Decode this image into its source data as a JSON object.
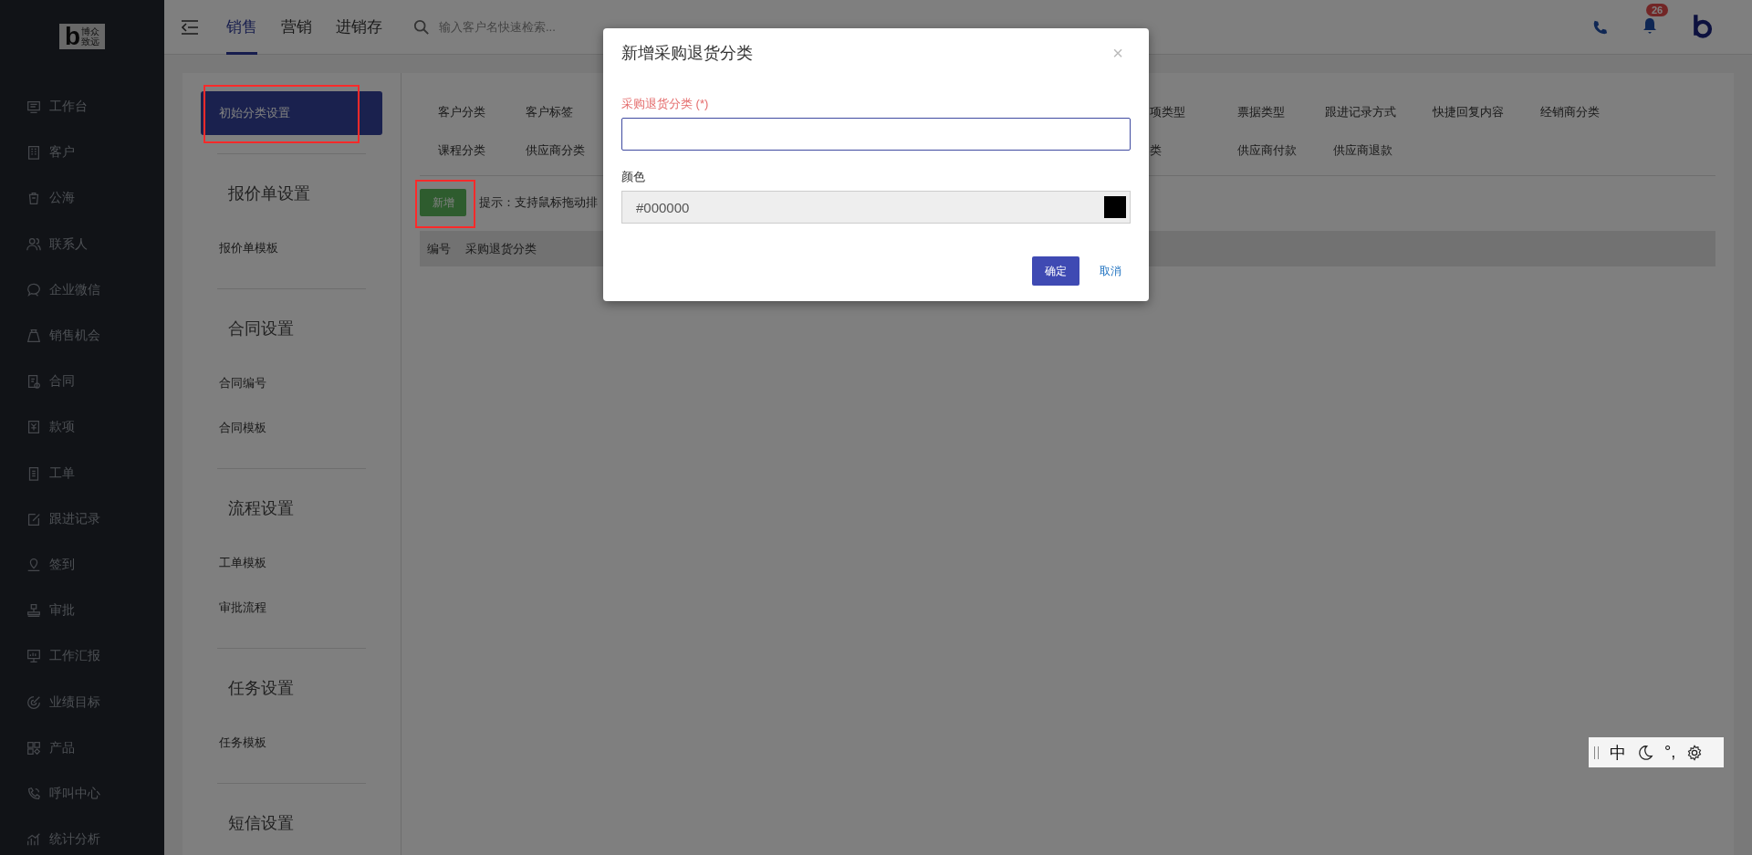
{
  "sidebar": {
    "logo_mark": "b",
    "logo_text": [
      "博众",
      "致远"
    ],
    "items": [
      {
        "label": "工作台"
      },
      {
        "label": "客户"
      },
      {
        "label": "公海"
      },
      {
        "label": "联系人"
      },
      {
        "label": "企业微信"
      },
      {
        "label": "销售机会"
      },
      {
        "label": "合同"
      },
      {
        "label": "款项"
      },
      {
        "label": "工单"
      },
      {
        "label": "跟进记录"
      },
      {
        "label": "签到"
      },
      {
        "label": "审批"
      },
      {
        "label": "工作汇报"
      },
      {
        "label": "业绩目标"
      },
      {
        "label": "产品"
      },
      {
        "label": "呼叫中心"
      },
      {
        "label": "统计分析"
      }
    ]
  },
  "top_bar": {
    "tabs": [
      {
        "label": "销售",
        "selected": true
      },
      {
        "label": "营销",
        "selected": false
      },
      {
        "label": "进销存",
        "selected": false
      }
    ],
    "search": {
      "placeholder": "输入客户名快速检索..."
    },
    "notification_count": "26"
  },
  "settings_nav": {
    "items": [
      {
        "label": "初始分类设置",
        "selected": true
      }
    ],
    "sections": [
      {
        "title": "报价单设置",
        "items": [
          {
            "label": "报价单模板",
            "selected": false
          }
        ]
      },
      {
        "title": "合同设置",
        "items": [
          {
            "label": "合同编号",
            "selected": false
          },
          {
            "label": "合同模板",
            "selected": false
          }
        ]
      },
      {
        "title": "流程设置",
        "items": [
          {
            "label": "工单模板",
            "selected": false
          },
          {
            "label": "审批流程",
            "selected": false
          }
        ]
      },
      {
        "title": "任务设置",
        "items": [
          {
            "label": "任务模板",
            "selected": false
          }
        ]
      },
      {
        "title": "短信设置"
      }
    ]
  },
  "category_tabs": [
    {
      "left": [
        "客户分类",
        "客户标签"
      ],
      "right": [
        "项类型",
        "票据类型",
        "跟进记录方式",
        "快捷回复内容",
        "经销商分类"
      ]
    },
    {
      "left": [
        "课程分类",
        "供应商分类"
      ],
      "right": [
        "类",
        "供应商付款",
        "供应商退款"
      ]
    }
  ],
  "add_button": "新增",
  "hint": "提示：支持鼠标拖动排",
  "table": {
    "columns": [
      "编号",
      "采购退货分类"
    ]
  },
  "dialog": {
    "title": "新增采购退货分类",
    "close": "×",
    "fields": [
      {
        "kind": "text",
        "label": "采购退货分类 (*)",
        "required": true
      },
      {
        "kind": "color",
        "label": "颜色",
        "value": "#000000",
        "color": "#000000"
      }
    ],
    "buttons": [
      {
        "label": "确定",
        "kind": "primary"
      },
      {
        "label": "取消",
        "kind": "link"
      }
    ]
  },
  "ime_toolbar": {
    "mode": "中",
    "punct": "°,"
  }
}
